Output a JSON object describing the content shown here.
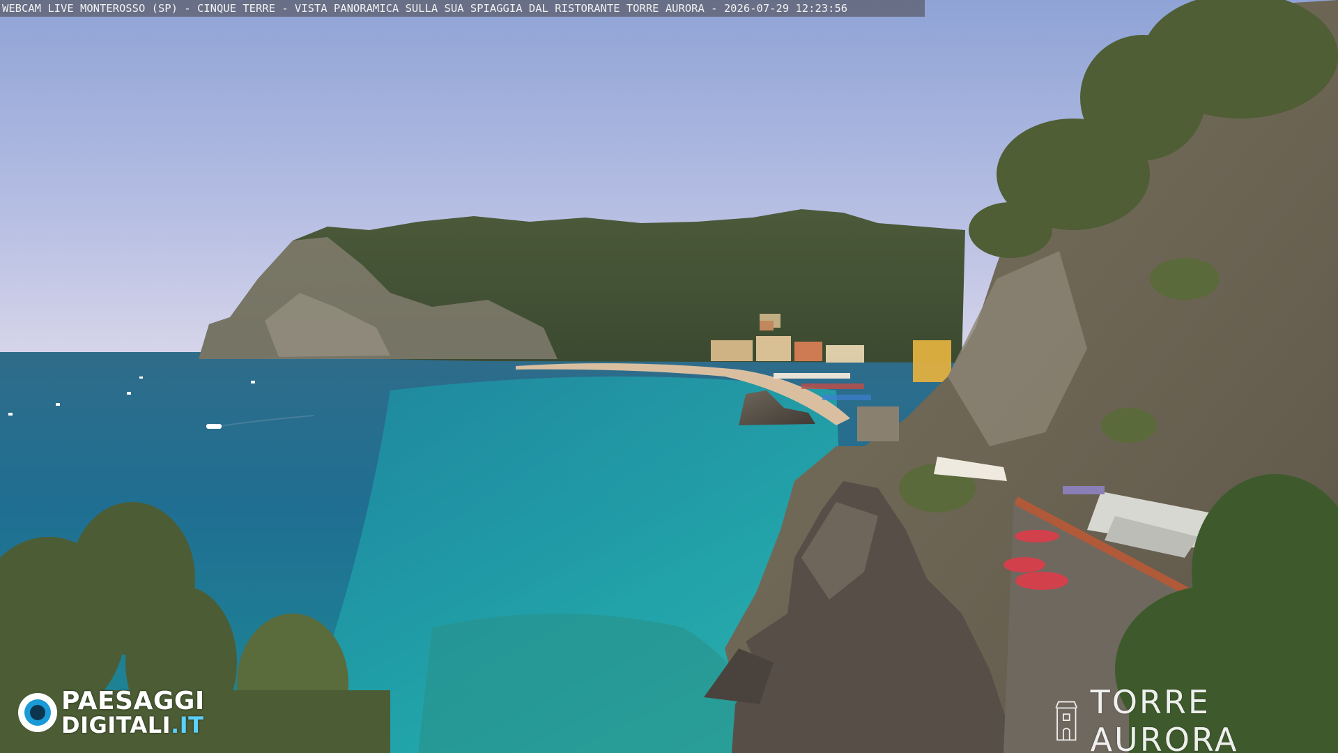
{
  "overlay": {
    "caption": "WEBCAM LIVE MONTEROSSO (SP) - CINQUE TERRE - VISTA PANORAMICA SULLA SUA SPIAGGIA DAL RISTORANTE TORRE AURORA - 2026-07-29 12:23:56"
  },
  "watermark_left": {
    "line1": "PAESAGGI",
    "line2_main": "DIGITALI",
    "line2_tld": ".IT",
    "icon": "eye-icon"
  },
  "watermark_right": {
    "text": "TORRE AURORA",
    "icon": "tower-icon"
  }
}
